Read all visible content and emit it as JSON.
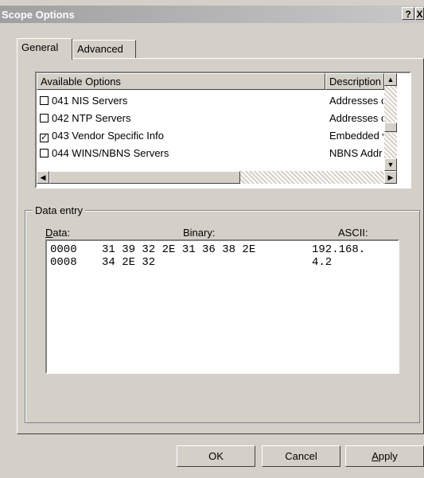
{
  "window": {
    "title": "Scope Options",
    "help_glyph": "?",
    "close_glyph": "X"
  },
  "tabs": [
    {
      "label": "General",
      "active": true
    },
    {
      "label": "Advanced",
      "active": false
    }
  ],
  "options_list": {
    "columns": [
      "Available Options",
      "Description"
    ],
    "rows": [
      {
        "label": "041 NIS Servers",
        "description": "Addresses c",
        "checked": false
      },
      {
        "label": "042 NTP Servers",
        "description": "Addresses c",
        "checked": false
      },
      {
        "label": "043 Vendor Specific Info",
        "description": "Embedded v",
        "checked": true
      },
      {
        "label": "044 WINS/NBNS Servers",
        "description": "NBNS Addr",
        "checked": false
      }
    ]
  },
  "data_entry": {
    "group_label": "Data entry",
    "col_data_prefix": "D",
    "col_data_rest": "ata:",
    "col_binary": "Binary:",
    "col_ascii": "ASCII:",
    "lines": [
      {
        "offset": "0000",
        "bytes": "31 39 32 2E 31 36 38 2E",
        "ascii": "192.168."
      },
      {
        "offset": "0008",
        "bytes": "34 2E 32",
        "ascii": "4.2"
      }
    ]
  },
  "buttons": {
    "ok": "OK",
    "cancel": "Cancel",
    "apply_prefix": "A",
    "apply_rest": "pply"
  }
}
